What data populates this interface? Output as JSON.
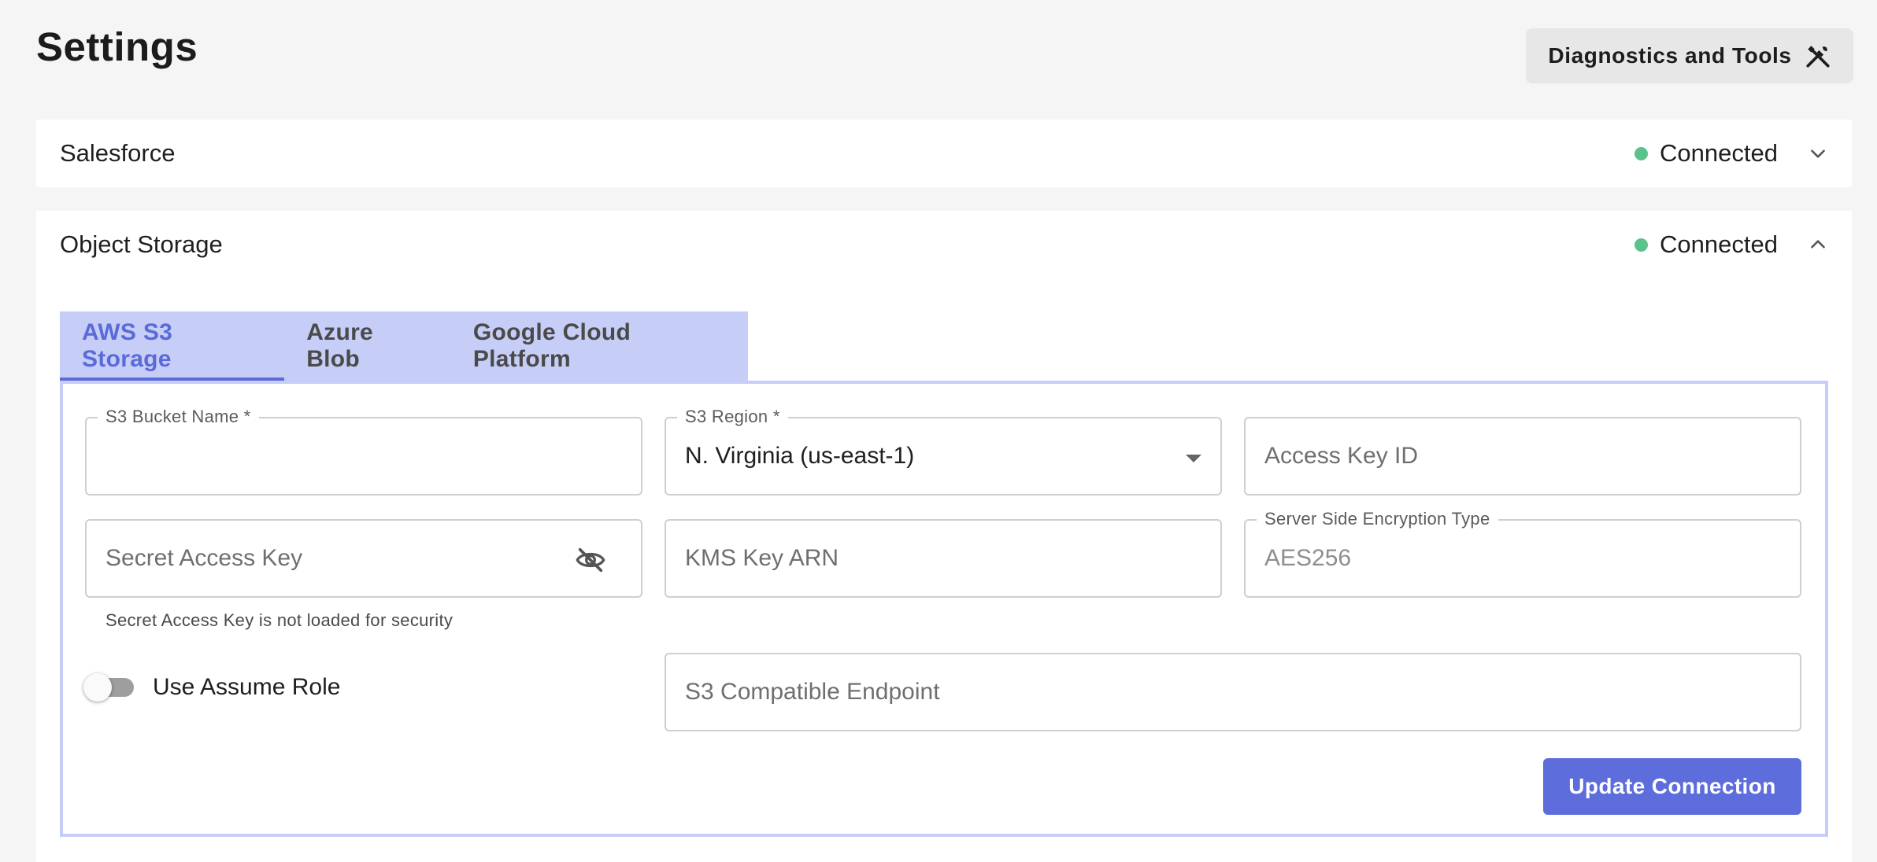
{
  "page": {
    "title": "Settings"
  },
  "header": {
    "diagnostics_label": "Diagnostics and Tools",
    "diagnostics_icon": "tools-icon"
  },
  "connections": {
    "salesforce": {
      "title": "Salesforce",
      "status": "Connected",
      "expanded": false
    },
    "object_storage": {
      "title": "Object Storage",
      "status": "Connected",
      "expanded": true
    }
  },
  "colors": {
    "status_connected": "#5bc28c",
    "accent": "#5d6ddc",
    "tab_bg": "#c6cdf7"
  },
  "tabs": [
    {
      "label": "AWS S3 Storage",
      "active": true
    },
    {
      "label": "Azure Blob",
      "active": false
    },
    {
      "label": "Google Cloud Platform",
      "active": false
    }
  ],
  "form": {
    "bucket": {
      "label": "S3 Bucket Name *",
      "value": ""
    },
    "region": {
      "label": "S3 Region *",
      "value": "N. Virginia (us-east-1)"
    },
    "access_key": {
      "placeholder": "Access Key ID"
    },
    "secret_key": {
      "placeholder": "Secret Access Key",
      "helper": "Secret Access Key is not loaded for security"
    },
    "kms": {
      "placeholder": "KMS Key ARN"
    },
    "sse": {
      "label": "Server Side Encryption Type",
      "value": "AES256"
    },
    "assume_role": {
      "label": "Use Assume Role",
      "enabled": false
    },
    "endpoint": {
      "placeholder": "S3 Compatible Endpoint"
    },
    "submit_label": "Update Connection"
  }
}
